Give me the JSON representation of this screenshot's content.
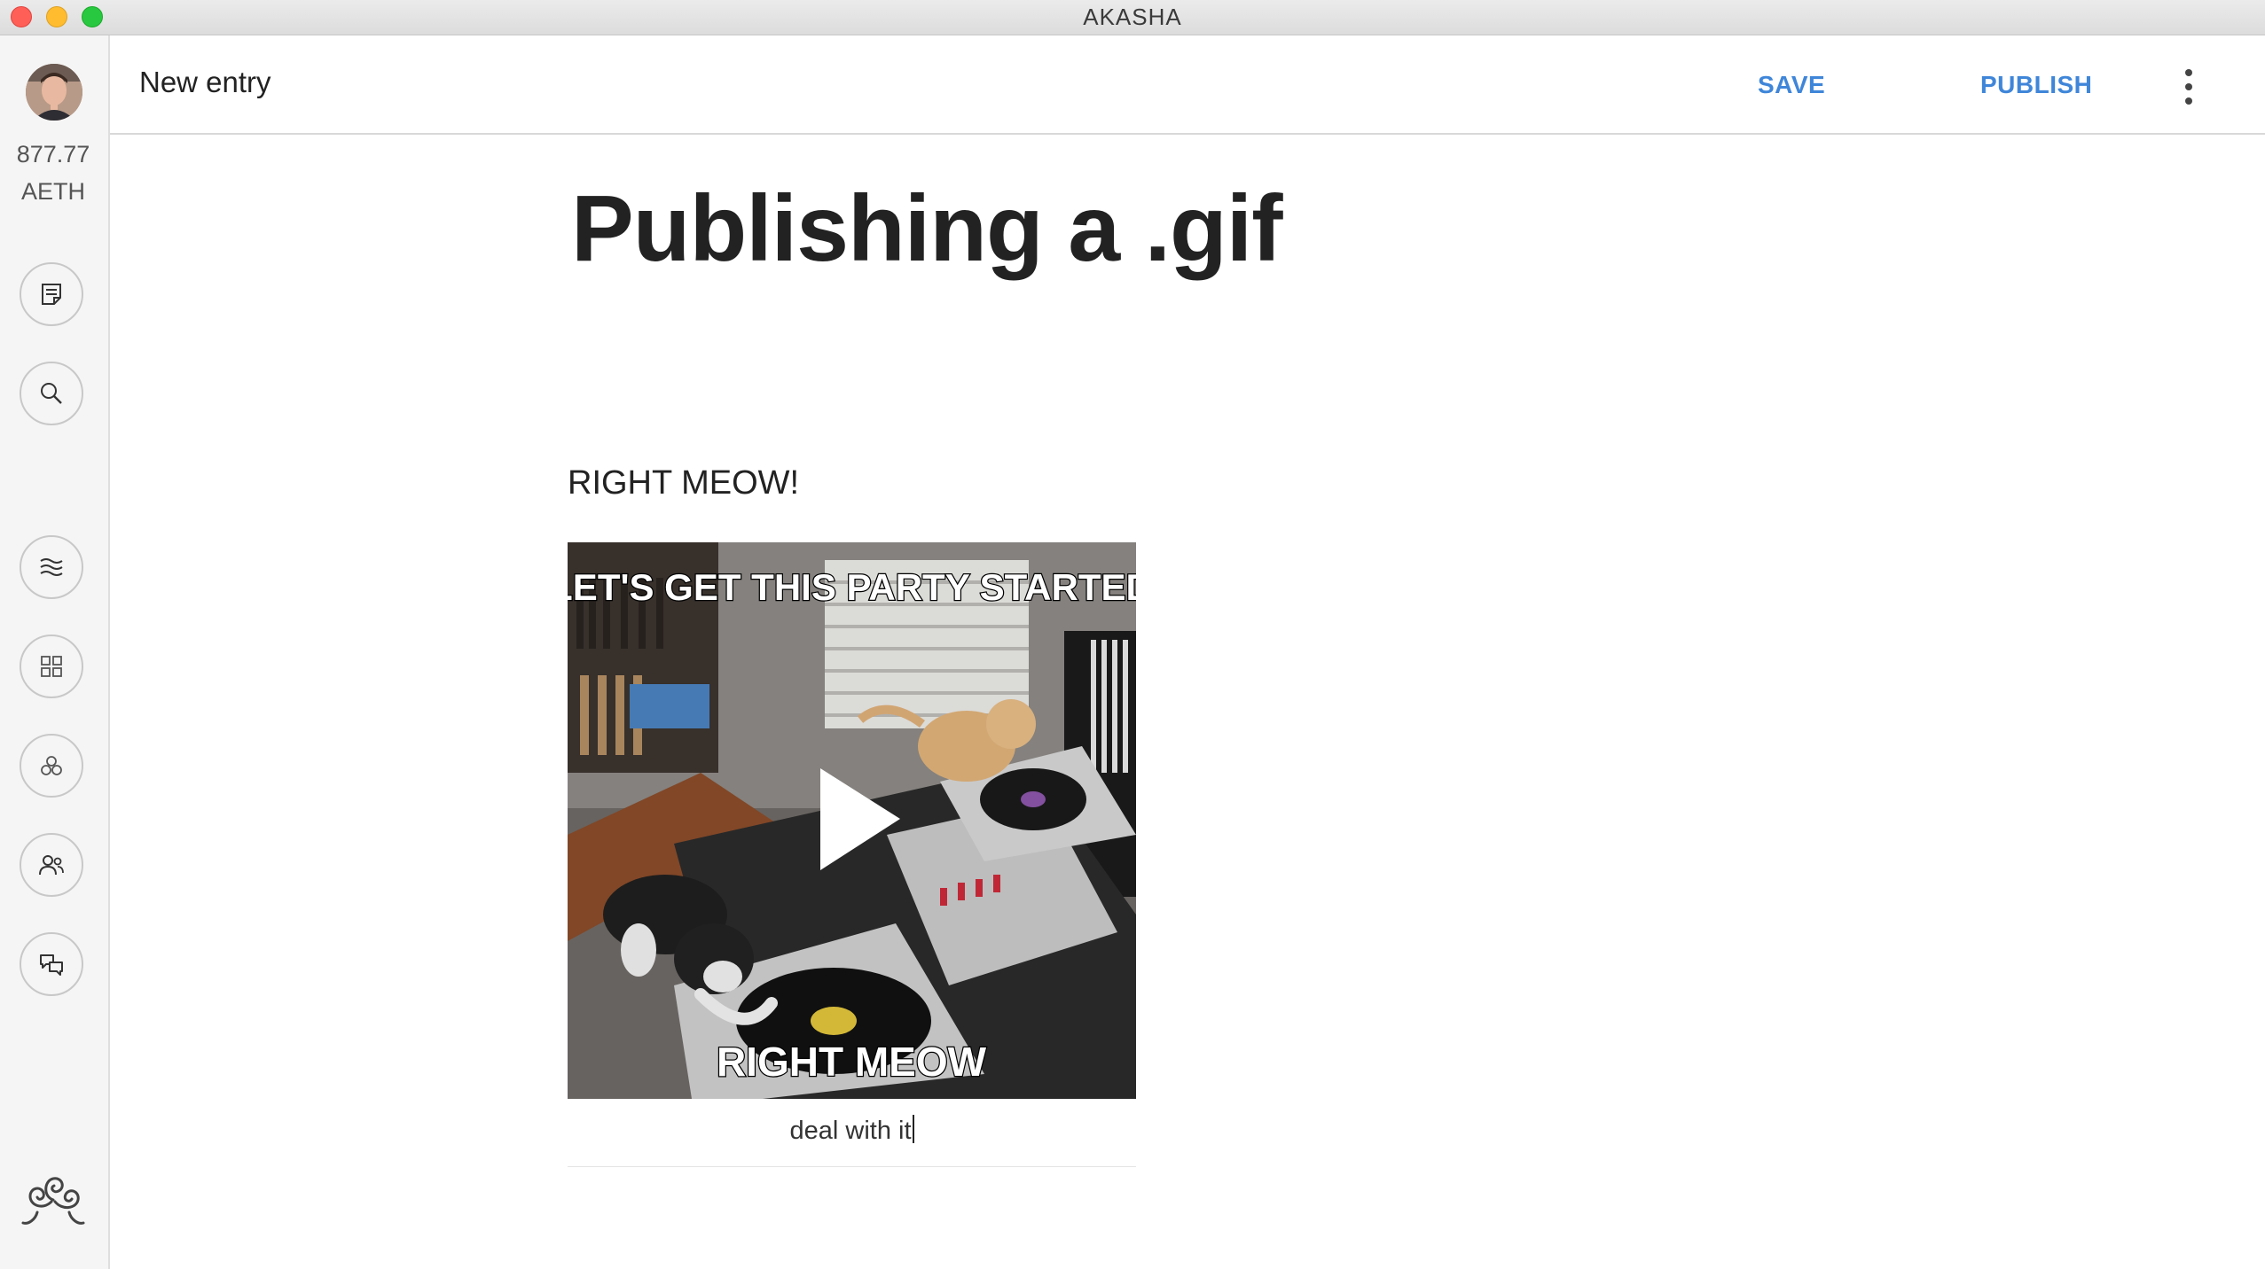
{
  "window": {
    "title": "AKASHA"
  },
  "sidebar": {
    "balance_amount": "877.77",
    "balance_unit": "AETH",
    "nav": [
      {
        "name": "new-entry-icon"
      },
      {
        "name": "search-icon"
      },
      {
        "name": "stream-icon"
      },
      {
        "name": "grid-icon"
      },
      {
        "name": "tags-icon"
      },
      {
        "name": "people-icon"
      },
      {
        "name": "chat-icon"
      }
    ],
    "logo": "akasha-triskelion-logo"
  },
  "header": {
    "title": "New entry",
    "save_label": "SAVE",
    "publish_label": "PUBLISH",
    "menu_icon": "more-vertical-icon"
  },
  "editor": {
    "entry_title": "Publishing a .gif",
    "paragraph": "RIGHT MEOW!",
    "media": {
      "top_text": "LET'S GET THIS PARTY STARTED",
      "bottom_text": "RIGHT MEOW",
      "play_icon": "play-icon"
    },
    "caption": "deal with it"
  },
  "colors": {
    "accent": "#3f86d9",
    "sidebar_bg": "#f5f5f5"
  }
}
